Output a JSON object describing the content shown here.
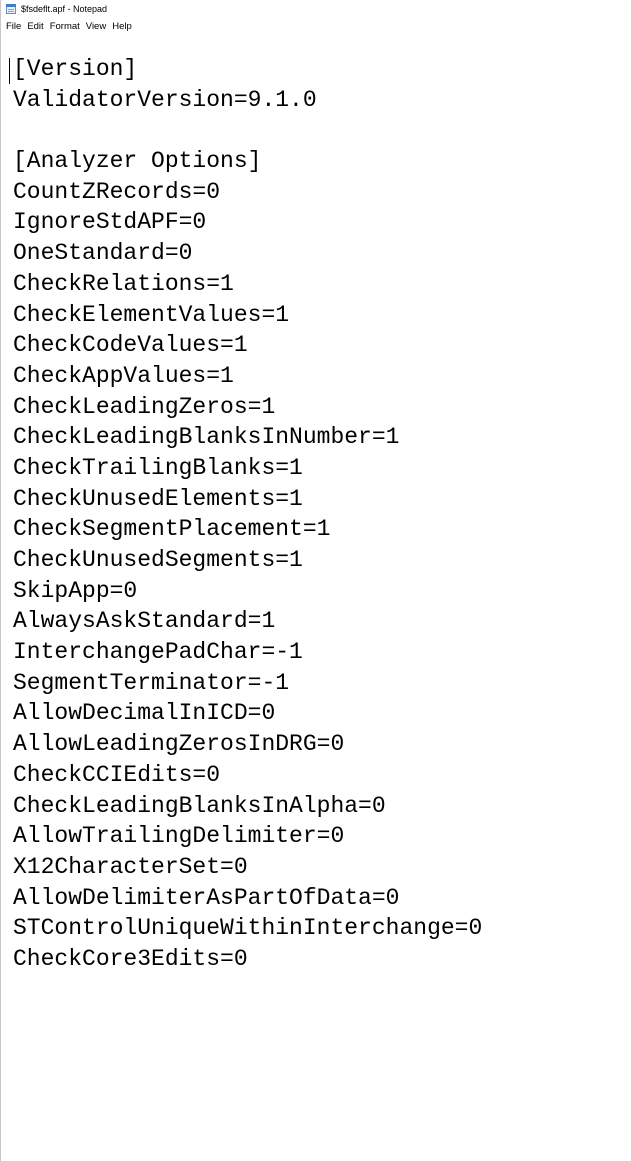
{
  "window": {
    "title": "$fsdeflt.apf - Notepad",
    "icon": "notepad-icon"
  },
  "menu": {
    "items": [
      "File",
      "Edit",
      "Format",
      "View",
      "Help"
    ]
  },
  "editor": {
    "lines": [
      "[Version]",
      "ValidatorVersion=9.1.0",
      "",
      "[Analyzer Options]",
      "CountZRecords=0",
      "IgnoreStdAPF=0",
      "OneStandard=0",
      "CheckRelations=1",
      "CheckElementValues=1",
      "CheckCodeValues=1",
      "CheckAppValues=1",
      "CheckLeadingZeros=1",
      "CheckLeadingBlanksInNumber=1",
      "CheckTrailingBlanks=1",
      "CheckUnusedElements=1",
      "CheckSegmentPlacement=1",
      "CheckUnusedSegments=1",
      "SkipApp=0",
      "AlwaysAskStandard=1",
      "InterchangePadChar=-1",
      "SegmentTerminator=-1",
      "AllowDecimalInICD=0",
      "AllowLeadingZerosInDRG=0",
      "CheckCCIEdits=0",
      "CheckLeadingBlanksInAlpha=0",
      "AllowTrailingDelimiter=0",
      "X12CharacterSet=0",
      "AllowDelimiterAsPartOfData=0",
      "STControlUniqueWithinInterchange=0",
      "CheckCore3Edits=0"
    ]
  }
}
